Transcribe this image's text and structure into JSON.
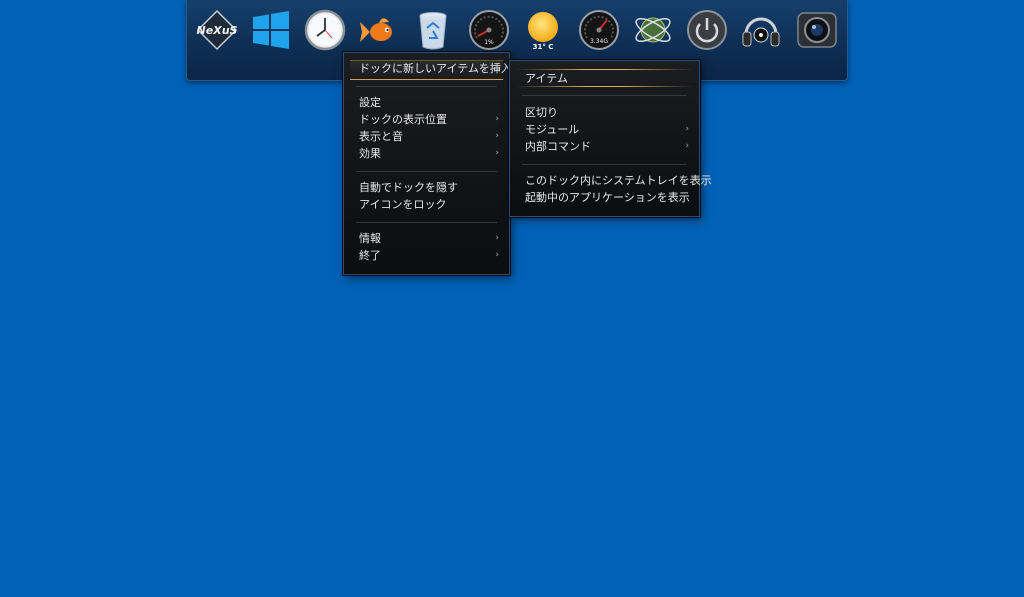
{
  "dock": {
    "icons": [
      {
        "name": "nexus-logo-icon",
        "label": "NeXuS"
      },
      {
        "name": "windows-logo-icon"
      },
      {
        "name": "clock-icon"
      },
      {
        "name": "goldfish-icon"
      },
      {
        "name": "recycle-bin-icon"
      },
      {
        "name": "cpu-gauge-icon",
        "readout": "1%"
      },
      {
        "name": "weather-sun-icon",
        "readout": "31° C"
      },
      {
        "name": "memory-gauge-icon",
        "readout": "3.34G"
      },
      {
        "name": "atom-globe-icon"
      },
      {
        "name": "power-icon"
      },
      {
        "name": "headphones-icon"
      },
      {
        "name": "camera-icon"
      }
    ]
  },
  "context_menu": {
    "items": [
      {
        "label": "ドックに新しいアイテムを挿入",
        "submenu": true
      },
      {
        "label": "設定"
      },
      {
        "label": "ドックの表示位置",
        "submenu": true
      },
      {
        "label": "表示と音",
        "submenu": true
      },
      {
        "label": "効果",
        "submenu": true
      },
      {
        "label": "自動でドックを隠す"
      },
      {
        "label": "アイコンをロック"
      },
      {
        "label": "情報",
        "submenu": true
      },
      {
        "label": "終了",
        "submenu": true
      }
    ]
  },
  "submenu": {
    "items": [
      {
        "label": "アイテム"
      },
      {
        "label": "区切り"
      },
      {
        "label": "モジュール",
        "submenu": true
      },
      {
        "label": "内部コマンド",
        "submenu": true
      },
      {
        "label": "このドック内にシステムトレイを表示"
      },
      {
        "label": "起動中のアプリケーションを表示"
      }
    ]
  },
  "arrow_glyph": "›"
}
